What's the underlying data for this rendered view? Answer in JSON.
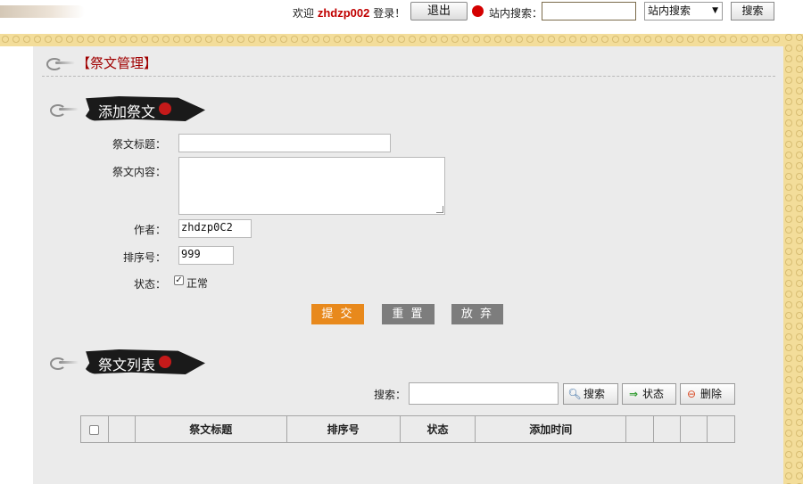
{
  "header": {
    "welcome_prefix": "欢迎",
    "username": "zhdzp002",
    "welcome_suffix": "登录！",
    "logout_label": "退出",
    "site_search_label": "站内搜索：",
    "site_search_value": "",
    "search_scope_selected": "站内搜索",
    "search_button_label": "搜索"
  },
  "page": {
    "title": "【祭文管理】"
  },
  "add_section": {
    "banner_label": "添加祭文",
    "fields": {
      "title_label": "祭文标题：",
      "title_value": "",
      "content_label": "祭文内容：",
      "content_value": "",
      "author_label": "作者：",
      "author_value": "zhdzp0C2",
      "order_label": "排序号：",
      "order_value": "999",
      "status_label": "状态：",
      "status_checkbox_label": "正常",
      "status_checked": true
    },
    "buttons": {
      "submit": "提 交",
      "reset": "重 置",
      "cancel": "放 弃"
    }
  },
  "list_section": {
    "banner_label": "祭文列表",
    "search_label": "搜索：",
    "search_value": "",
    "search_button": "搜索",
    "status_button": "状态",
    "delete_button": "删除",
    "columns": [
      "祭文标题",
      "排序号",
      "状态",
      "添加时间"
    ]
  },
  "colors": {
    "accent_orange": "#e8891c",
    "button_gray": "#7d7d7d",
    "title_red": "#a00000",
    "username_red": "#c00000",
    "panel_bg": "#ebebeb",
    "deco_gold": "#f3dd9a"
  },
  "icons": {
    "status_dot": "red-dot-icon",
    "search": "magnifier-icon",
    "status": "green-arrow-icon",
    "delete": "minus-circle-icon",
    "section": "cloud-icon"
  }
}
